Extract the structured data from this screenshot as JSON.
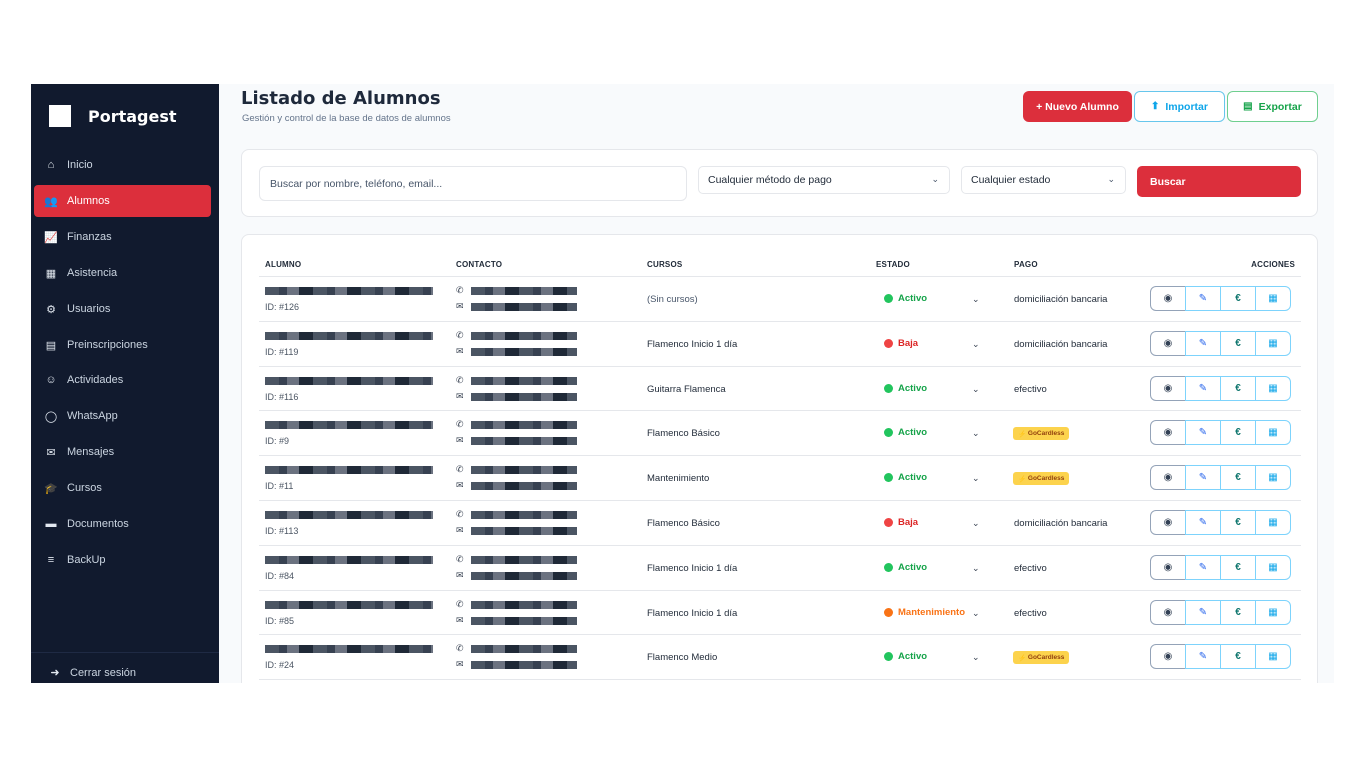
{
  "sidebar": {
    "brand": "Portagest",
    "items": [
      {
        "label": "Inicio",
        "icon": "home-icon"
      },
      {
        "label": "Alumnos",
        "icon": "users-icon",
        "active": true
      },
      {
        "label": "Finanzas",
        "icon": "chart-icon"
      },
      {
        "label": "Asistencia",
        "icon": "calendar-check-icon"
      },
      {
        "label": "Usuarios",
        "icon": "user-cog-icon"
      },
      {
        "label": "Preinscripciones",
        "icon": "clipboard-icon"
      },
      {
        "label": "Actividades",
        "icon": "masks-icon"
      },
      {
        "label": "WhatsApp",
        "icon": "whatsapp-icon"
      },
      {
        "label": "Mensajes",
        "icon": "envelope-icon"
      },
      {
        "label": "Cursos",
        "icon": "graduation-cap-icon"
      },
      {
        "label": "Documentos",
        "icon": "folder-icon"
      },
      {
        "label": "BackUp",
        "icon": "database-icon"
      }
    ],
    "logout_label": "Cerrar sesión"
  },
  "header": {
    "title": "Listado de Alumnos",
    "subtitle": "Gestión y control de la base de datos de alumnos",
    "new_label": "+ Nuevo Alumno",
    "import_label": "Importar",
    "export_label": "Exportar"
  },
  "filters": {
    "search_placeholder": "Buscar por nombre, teléfono, email...",
    "payment_value": "Cualquier método de pago",
    "state_value": "Cualquier estado",
    "search_button": "Buscar"
  },
  "table": {
    "columns": [
      "ALUMNO",
      "CONTACTO",
      "CURSOS",
      "ESTADO",
      "PAGO",
      "ACCIONES"
    ],
    "rows": [
      {
        "id": "ID: #126",
        "course": "(Sin cursos)",
        "status": "Activo",
        "payment": "domiciliación bancaria"
      },
      {
        "id": "ID: #119",
        "course": "Flamenco Inicio 1 día",
        "status": "Baja",
        "payment": "domiciliación bancaria"
      },
      {
        "id": "ID: #116",
        "course": "Guitarra Flamenca",
        "status": "Activo",
        "payment": "efectivo"
      },
      {
        "id": "ID: #9",
        "course": "Flamenco Básico",
        "status": "Activo",
        "payment": "GoCardless"
      },
      {
        "id": "ID: #11",
        "course": "Mantenimiento",
        "status": "Activo",
        "payment": "GoCardless"
      },
      {
        "id": "ID: #113",
        "course": "Flamenco Básico",
        "status": "Baja",
        "payment": "domiciliación bancaria"
      },
      {
        "id": "ID: #84",
        "course": "Flamenco Inicio 1 día",
        "status": "Activo",
        "payment": "efectivo"
      },
      {
        "id": "ID: #85",
        "course": "Flamenco Inicio 1 día",
        "status": "Mantenimiento",
        "payment": "efectivo"
      },
      {
        "id": "ID: #24",
        "course": "Flamenco Medio",
        "status": "Activo",
        "payment": "GoCardless"
      }
    ]
  },
  "colors": {
    "accent": "#dc2f3c",
    "sidebar_bg": "#111a2e",
    "activo": "#22c55e",
    "baja": "#ef4444",
    "mantenimiento": "#f97316",
    "gocardless_badge": "#fcd34d"
  }
}
